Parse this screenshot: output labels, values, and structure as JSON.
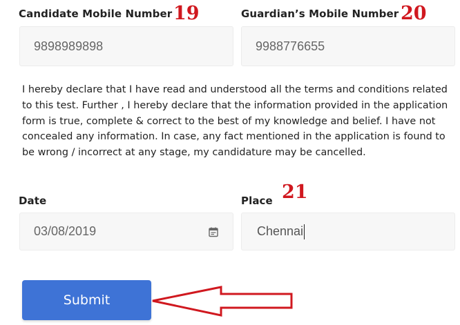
{
  "fields": {
    "candidate_mobile": {
      "label": "Candidate Mobile Number",
      "value": "9898989898"
    },
    "guardian_mobile": {
      "label": "Guardian’s Mobile Number",
      "value": "9988776655"
    },
    "date": {
      "label": "Date",
      "value": "03/08/2019"
    },
    "place": {
      "label": "Place",
      "value": "Chennai"
    }
  },
  "declaration": "I hereby declare that I have read and understood all the terms and conditions related to this test. Further , I hereby declare that the information provided in the application form is true, complete & correct to the best of my knowledge and belief. I have not concealed any information. In case, any fact mentioned in the application is found to be wrong / incorrect at any stage, my candidature may be cancelled.",
  "submit_label": "Submit",
  "annotations": {
    "n19": "19",
    "n20": "20",
    "n21": "21",
    "color": "#d0181f"
  },
  "colors": {
    "submit_bg": "#3e73d6",
    "field_bg": "#f7f7f7"
  },
  "icons": {
    "date_picker": "calendar-icon"
  }
}
